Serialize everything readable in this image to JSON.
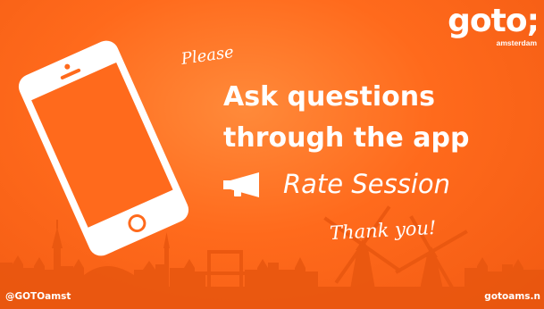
{
  "colors": {
    "background": "#ff6a1c",
    "skyline": "#e8560f",
    "text": "#ffffff"
  },
  "logo": {
    "word": "goto;",
    "city": "amsterdam"
  },
  "slide": {
    "please": "Please",
    "headline_line1": "Ask questions",
    "headline_line2": "through the app",
    "rate_label": "Rate Session",
    "thanks": "Thank you!"
  },
  "icons": {
    "phone": "smartphone-icon",
    "megaphone": "megaphone-icon"
  },
  "footer": {
    "handle": "@GOTOamst",
    "website": "gotoams.n"
  }
}
